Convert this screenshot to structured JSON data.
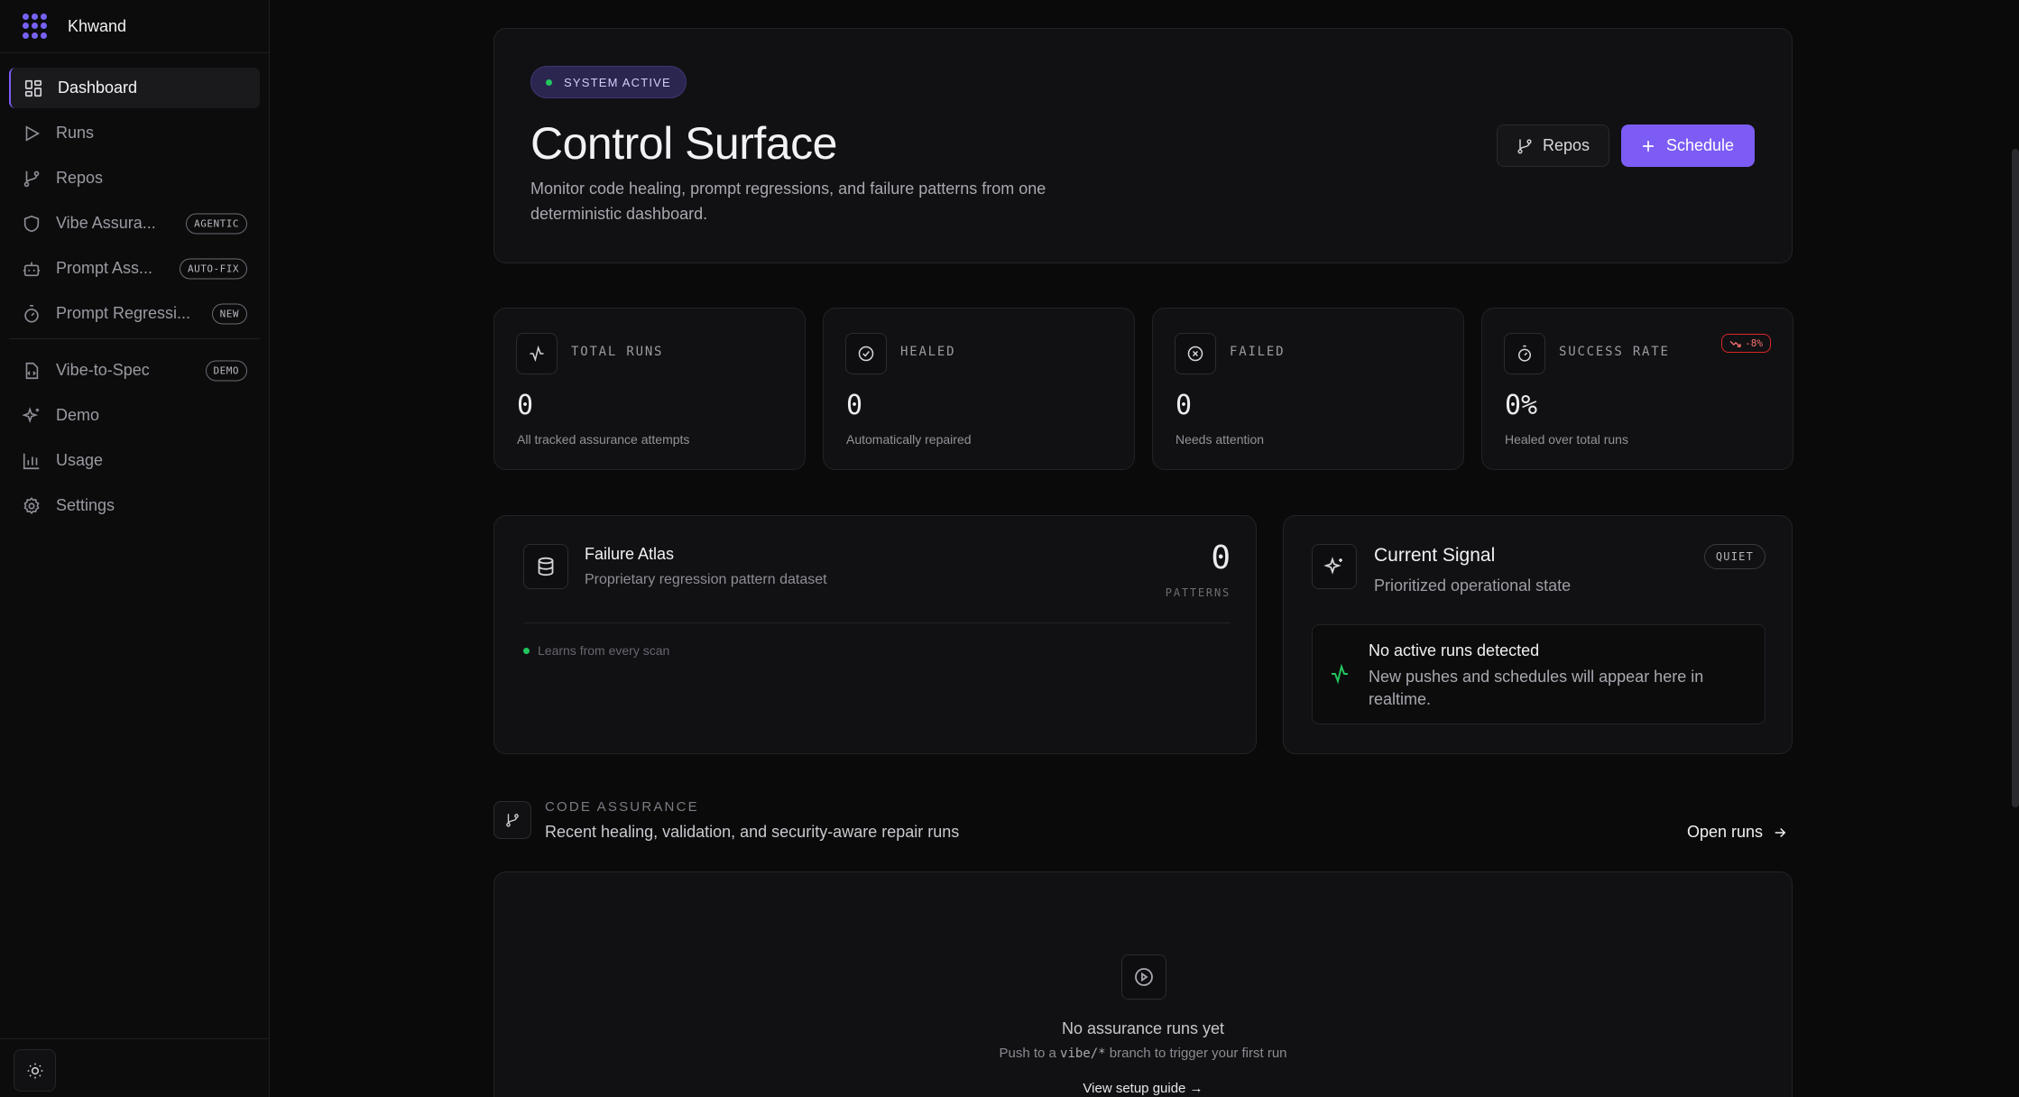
{
  "app": {
    "name": "Khwand"
  },
  "sidebar": {
    "items": [
      {
        "label": "Dashboard",
        "icon": "dashboard-icon",
        "active": true
      },
      {
        "label": "Runs",
        "icon": "play-icon"
      },
      {
        "label": "Repos",
        "icon": "git-branch-icon"
      },
      {
        "label": "Vibe Assura...",
        "icon": "shield-icon",
        "badge": "AGENTIC"
      },
      {
        "label": "Prompt Ass...",
        "icon": "bot-icon",
        "badge": "AUTO-FIX"
      },
      {
        "label": "Prompt Regressi...",
        "icon": "timer-icon",
        "badge": "NEW"
      },
      {
        "label": "Vibe-to-Spec",
        "icon": "file-spec-icon",
        "badge": "DEMO"
      },
      {
        "label": "Demo",
        "icon": "sparkles-icon"
      },
      {
        "label": "Usage",
        "icon": "bar-chart-icon"
      },
      {
        "label": "Settings",
        "icon": "gear-icon"
      }
    ]
  },
  "hero": {
    "status": "SYSTEM ACTIVE",
    "title": "Control Surface",
    "description": "Monitor code healing, prompt regressions, and failure patterns from one deterministic dashboard.",
    "repos_button": "Repos",
    "schedule_button": "Schedule"
  },
  "stats": [
    {
      "label": "TOTAL RUNS",
      "value": "0",
      "sub": "All tracked assurance attempts",
      "icon": "activity-icon"
    },
    {
      "label": "HEALED",
      "value": "0",
      "sub": "Automatically repaired",
      "icon": "check-circle-icon"
    },
    {
      "label": "FAILED",
      "value": "0",
      "sub": "Needs attention",
      "icon": "x-circle-icon"
    },
    {
      "label": "SUCCESS RATE",
      "value": "0%",
      "sub": "Healed over total runs",
      "icon": "timer-icon",
      "delta": "-8%"
    }
  ],
  "atlas": {
    "title": "Failure Atlas",
    "subtitle": "Proprietary regression pattern dataset",
    "count": "0",
    "count_label": "PATTERNS",
    "note": "Learns from every scan"
  },
  "signal": {
    "title": "Current Signal",
    "subtitle": "Prioritized operational state",
    "badge": "QUIET",
    "headline": "No active runs detected",
    "detail": "New pushes and schedules will appear here in realtime."
  },
  "code_assurance": {
    "kicker": "CODE ASSURANCE",
    "title": "Recent healing, validation, and security-aware repair runs",
    "open_runs": "Open runs",
    "empty_title": "No assurance runs yet",
    "empty_pre": "Push to a ",
    "empty_code": "vibe/*",
    "empty_post": " branch to trigger your first run",
    "guide_link": "View setup guide →"
  },
  "colors": {
    "accent": "#7c5cf5",
    "success": "#22c55e",
    "danger": "#dc2626"
  }
}
